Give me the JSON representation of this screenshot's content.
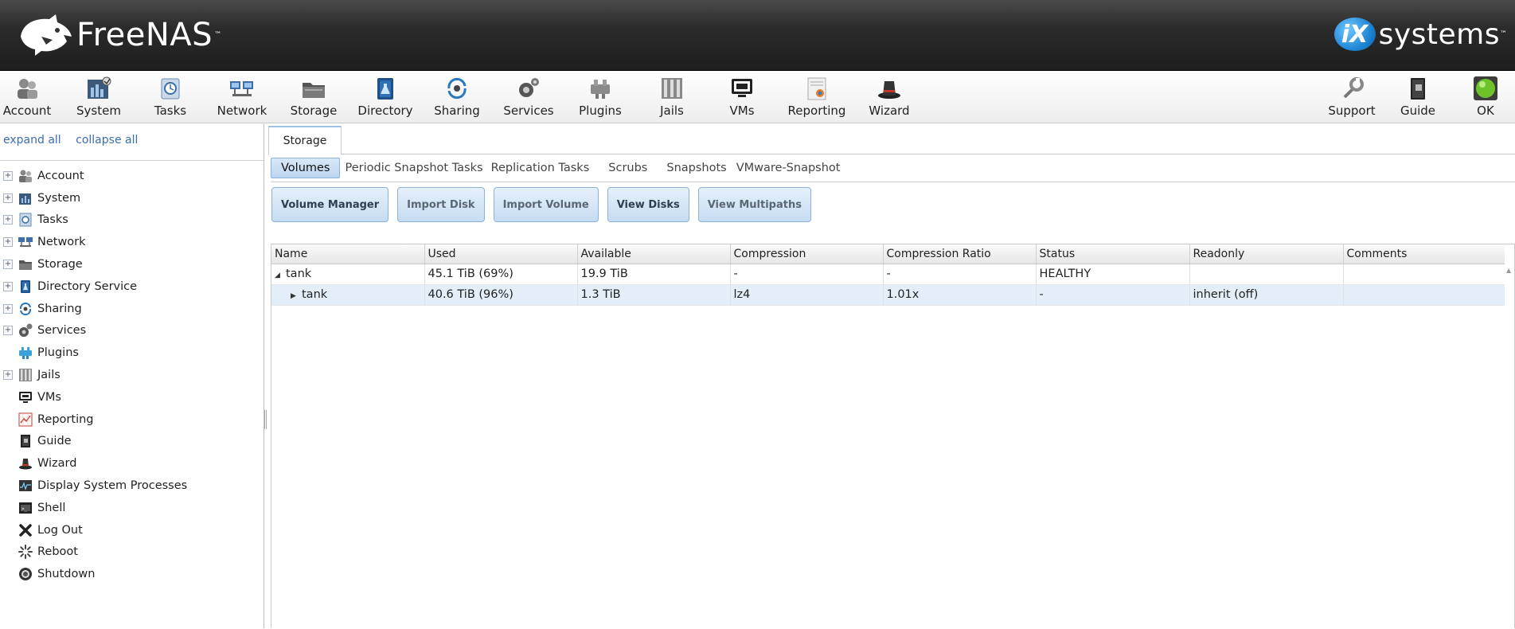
{
  "header": {
    "brand": "FreeNAS",
    "partner_mark": "iX",
    "partner_name": "systems",
    "trademark": "™"
  },
  "toolbar": {
    "items": [
      {
        "label": "Account",
        "icon": "account-icon"
      },
      {
        "label": "System",
        "icon": "system-icon"
      },
      {
        "label": "Tasks",
        "icon": "tasks-icon"
      },
      {
        "label": "Network",
        "icon": "network-icon"
      },
      {
        "label": "Storage",
        "icon": "storage-icon"
      },
      {
        "label": "Directory",
        "icon": "directory-icon"
      },
      {
        "label": "Sharing",
        "icon": "sharing-icon"
      },
      {
        "label": "Services",
        "icon": "services-icon"
      },
      {
        "label": "Plugins",
        "icon": "plugins-icon"
      },
      {
        "label": "Jails",
        "icon": "jails-icon"
      },
      {
        "label": "VMs",
        "icon": "vms-icon"
      },
      {
        "label": "Reporting",
        "icon": "reporting-icon"
      },
      {
        "label": "Wizard",
        "icon": "wizard-icon"
      }
    ],
    "right_items": [
      {
        "label": "Support",
        "icon": "support-icon"
      },
      {
        "label": "Guide",
        "icon": "guide-icon"
      },
      {
        "label": "OK",
        "icon": "alert-ok-icon",
        "color": "#6ec32a"
      }
    ]
  },
  "sidebar": {
    "expand_all": "expand all",
    "collapse_all": "collapse all",
    "items": [
      {
        "label": "Account",
        "expandable": true
      },
      {
        "label": "System",
        "expandable": true
      },
      {
        "label": "Tasks",
        "expandable": true
      },
      {
        "label": "Network",
        "expandable": true
      },
      {
        "label": "Storage",
        "expandable": true
      },
      {
        "label": "Directory Service",
        "expandable": true
      },
      {
        "label": "Sharing",
        "expandable": true
      },
      {
        "label": "Services",
        "expandable": true
      },
      {
        "label": "Plugins",
        "expandable": false
      },
      {
        "label": "Jails",
        "expandable": true
      },
      {
        "label": "VMs",
        "expandable": false
      },
      {
        "label": "Reporting",
        "expandable": false
      },
      {
        "label": "Guide",
        "expandable": false
      },
      {
        "label": "Wizard",
        "expandable": false
      },
      {
        "label": "Display System Processes",
        "expandable": false
      },
      {
        "label": "Shell",
        "expandable": false
      },
      {
        "label": "Log Out",
        "expandable": false
      },
      {
        "label": "Reboot",
        "expandable": false
      },
      {
        "label": "Shutdown",
        "expandable": false
      }
    ]
  },
  "main": {
    "tab": "Storage",
    "subtabs": [
      "Volumes",
      "Periodic Snapshot Tasks",
      "Replication Tasks",
      "Scrubs",
      "Snapshots",
      "VMware-Snapshot"
    ],
    "active_subtab": "Volumes",
    "actions": [
      "Volume Manager",
      "Import Disk",
      "Import Volume",
      "View Disks",
      "View Multipaths"
    ],
    "columns": [
      "Name",
      "Used",
      "Available",
      "Compression",
      "Compression Ratio",
      "Status",
      "Readonly",
      "Comments"
    ],
    "rows": [
      {
        "name": "tank",
        "used": "45.1 TiB (69%)",
        "available": "19.9 TiB",
        "compression": "-",
        "ratio": "-",
        "status": "HEALTHY",
        "readonly": "",
        "comments": "",
        "expanded": true
      },
      {
        "name": "tank",
        "used": "40.6 TiB (96%)",
        "available": "1.3 TiB",
        "compression": "lz4",
        "ratio": "1.01x",
        "status": "-",
        "readonly": "inherit (off)",
        "comments": "",
        "expanded": false
      }
    ]
  }
}
